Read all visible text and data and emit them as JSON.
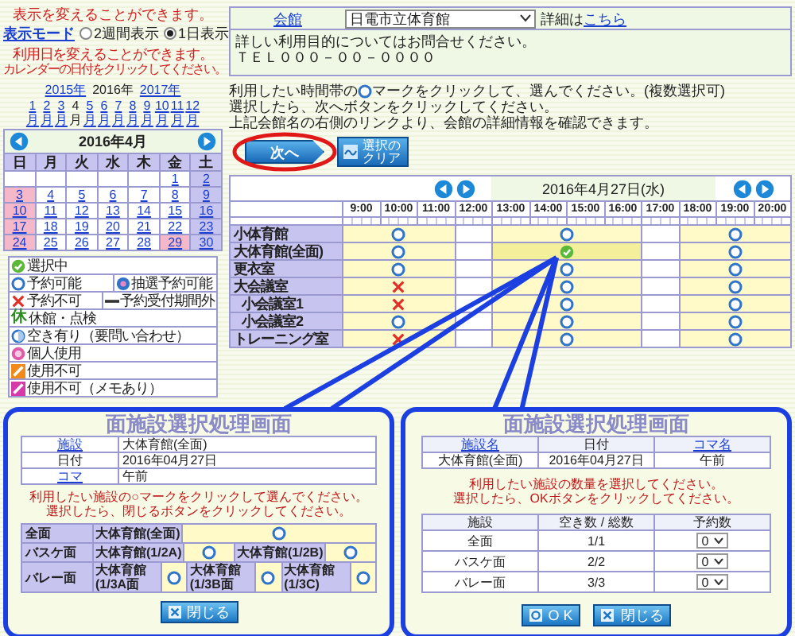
{
  "mode_panel": {
    "hint": "表示を変えることができます。",
    "label": "表示モード",
    "options": [
      {
        "label": "2週間表示",
        "selected": false
      },
      {
        "label": "1日表示",
        "selected": true
      }
    ]
  },
  "date_hint": [
    "利用日を変えることができます。",
    "カレンダーの日付をクリックしてください。"
  ],
  "calendar": {
    "years": [
      {
        "label": "2015年",
        "selected": false
      },
      {
        "label": "2016年",
        "selected": true
      },
      {
        "label": "2017年",
        "selected": false
      }
    ],
    "months": [
      {
        "number": "1",
        "unit": "月",
        "selected": false
      },
      {
        "number": "2",
        "unit": "月",
        "selected": false
      },
      {
        "number": "3",
        "unit": "月",
        "selected": false
      },
      {
        "number": "4",
        "unit": "月",
        "selected": true
      },
      {
        "number": "5",
        "unit": "月",
        "selected": false
      },
      {
        "number": "6",
        "unit": "月",
        "selected": false
      },
      {
        "number": "7",
        "unit": "月",
        "selected": false
      },
      {
        "number": "8",
        "unit": "月",
        "selected": false
      },
      {
        "number": "9",
        "unit": "月",
        "selected": false
      },
      {
        "number": "10",
        "unit": "月",
        "selected": false
      },
      {
        "number": "11",
        "unit": "月",
        "selected": false
      },
      {
        "number": "12",
        "unit": "月",
        "selected": false
      }
    ],
    "title": "2016年4月",
    "weekdays": [
      "日",
      "月",
      "火",
      "水",
      "木",
      "金",
      "土"
    ],
    "weeks": [
      [
        {
          "kind": "empty"
        },
        {
          "kind": "empty"
        },
        {
          "kind": "empty"
        },
        {
          "kind": "empty"
        },
        {
          "kind": "empty"
        },
        {
          "day": "1",
          "kind": "weekday"
        },
        {
          "day": "2",
          "kind": "saturday"
        }
      ],
      [
        {
          "day": "3",
          "kind": "sunday"
        },
        {
          "day": "4",
          "kind": "weekday"
        },
        {
          "day": "5",
          "kind": "weekday"
        },
        {
          "day": "6",
          "kind": "weekday"
        },
        {
          "day": "7",
          "kind": "weekday"
        },
        {
          "day": "8",
          "kind": "weekday"
        },
        {
          "day": "9",
          "kind": "saturday"
        }
      ],
      [
        {
          "day": "10",
          "kind": "sunday"
        },
        {
          "day": "11",
          "kind": "weekday"
        },
        {
          "day": "12",
          "kind": "weekday"
        },
        {
          "day": "13",
          "kind": "weekday"
        },
        {
          "day": "14",
          "kind": "weekday"
        },
        {
          "day": "15",
          "kind": "weekday"
        },
        {
          "day": "16",
          "kind": "saturday"
        }
      ],
      [
        {
          "day": "17",
          "kind": "sunday"
        },
        {
          "day": "18",
          "kind": "weekday"
        },
        {
          "day": "19",
          "kind": "weekday"
        },
        {
          "day": "20",
          "kind": "weekday"
        },
        {
          "day": "21",
          "kind": "weekday"
        },
        {
          "day": "22",
          "kind": "weekday"
        },
        {
          "day": "23",
          "kind": "saturday"
        }
      ],
      [
        {
          "day": "24",
          "kind": "sunday"
        },
        {
          "day": "25",
          "kind": "weekday"
        },
        {
          "day": "26",
          "kind": "weekday"
        },
        {
          "day": "27",
          "kind": "weekday"
        },
        {
          "day": "28",
          "kind": "weekday"
        },
        {
          "day": "29",
          "kind": "sunday"
        },
        {
          "day": "30",
          "kind": "saturday"
        }
      ]
    ]
  },
  "legend": [
    [
      {
        "kind": "selected",
        "label": "選択中"
      }
    ],
    [
      {
        "kind": "available",
        "label": "予約可能"
      },
      {
        "kind": "lottery",
        "label": "抽選予約可能"
      }
    ],
    [
      {
        "kind": "unavailable",
        "label": "予約不可"
      },
      {
        "kind": "outside",
        "label": "予約受付期間外"
      }
    ],
    [
      {
        "kind": "closed",
        "glyph": "休",
        "label": "休館・点検"
      }
    ],
    [
      {
        "kind": "inquiry",
        "label": "空き有り（要問い合わせ）"
      }
    ],
    [
      {
        "kind": "personal",
        "label": "個人使用"
      }
    ],
    [
      {
        "kind": "unusable",
        "label": "使用不可"
      }
    ],
    [
      {
        "kind": "memo",
        "label": "使用不可（メモあり）"
      }
    ]
  ],
  "facility": {
    "label": "会館",
    "select": "日電市立体育館",
    "detail_prefix": "詳細は",
    "detail_link": "こちら"
  },
  "info": [
    "詳しい利用目的についてはお問合せください。",
    "ＴＥＬ０００－００－００００"
  ],
  "instructions": {
    "before_icon": "利用したい時間帯の",
    "after_icon": "マークをクリックして、選んでください。(複数選択可)",
    "lines": [
      "選択したら、次へボタンをクリックしてください。",
      "上記会館名の右側のリンクより、会館の詳細情報を確認できます。"
    ]
  },
  "buttons": {
    "next": "次へ",
    "clear": "選択のクリア"
  },
  "schedule": {
    "date": "2016年4月27日(水)",
    "hours": [
      "9:00",
      "10:00",
      "11:00",
      "12:00",
      "13:00",
      "14:00",
      "15:00",
      "16:00",
      "17:00",
      "18:00",
      "19:00",
      "20:00"
    ],
    "rows": [
      {
        "name": "小体育館",
        "slots": [
          {
            "kind": "available",
            "selected": false
          },
          {
            "kind": "blank"
          },
          {
            "kind": "available",
            "selected": false
          },
          {
            "kind": "blank"
          },
          {
            "kind": "available",
            "selected": false
          }
        ]
      },
      {
        "name": "大体育館(全面)",
        "slots": [
          {
            "kind": "available",
            "selected": false
          },
          {
            "kind": "blank"
          },
          {
            "kind": "available",
            "selected": true
          },
          {
            "kind": "blank"
          },
          {
            "kind": "available",
            "selected": false
          }
        ]
      },
      {
        "name": "更衣室",
        "slots": [
          {
            "kind": "available",
            "selected": false
          },
          {
            "kind": "blank"
          },
          {
            "kind": "available",
            "selected": false
          },
          {
            "kind": "blank"
          },
          {
            "kind": "available",
            "selected": false
          }
        ]
      },
      {
        "name": "大会議室",
        "slots": [
          {
            "kind": "unavailable"
          },
          {
            "kind": "blank"
          },
          {
            "kind": "available",
            "selected": false
          },
          {
            "kind": "blank"
          },
          {
            "kind": "available",
            "selected": false
          }
        ],
        "children": [
          {
            "name": "小会議室1",
            "slots": [
              {
                "kind": "unavailable"
              },
              {
                "kind": "blank"
              },
              {
                "kind": "available",
                "selected": false
              },
              {
                "kind": "blank"
              },
              {
                "kind": "available",
                "selected": false
              }
            ]
          },
          {
            "name": "小会議室2",
            "slots": [
              {
                "kind": "available",
                "selected": false
              },
              {
                "kind": "blank"
              },
              {
                "kind": "available",
                "selected": false
              },
              {
                "kind": "blank"
              },
              {
                "kind": "available",
                "selected": false
              }
            ]
          }
        ]
      },
      {
        "name": "トレーニング室",
        "slots": [
          {
            "kind": "unavailable"
          },
          {
            "kind": "blank"
          },
          {
            "kind": "available",
            "selected": false
          },
          {
            "kind": "blank"
          },
          {
            "kind": "available",
            "selected": false
          }
        ]
      }
    ]
  },
  "popup_left": {
    "title": "面施設選択処理画面",
    "info": [
      {
        "label": "施設",
        "link": true,
        "value": "大体育館(全面)"
      },
      {
        "label": "日付",
        "link": false,
        "value": "2016年04月27日"
      },
      {
        "label": "コマ",
        "link": true,
        "value": "午前"
      }
    ],
    "message": [
      "利用したい施設の○マークをクリックして選んでください。",
      "選択したら、閉じるボタンをクリックしてください。"
    ],
    "groups": [
      {
        "name": "全面",
        "choices": [
          {
            "label": "大体育館(全面)",
            "selected": false
          }
        ]
      },
      {
        "name": "バスケ面",
        "choices": [
          {
            "label": "大体育館(1/2A)",
            "selected": false
          },
          {
            "label": "大体育館(1/2B)",
            "selected": false
          }
        ]
      },
      {
        "name": "バレー面",
        "choices": [
          {
            "label": "大体育館(1/3A面",
            "selected": false
          },
          {
            "label": "大体育館(1/3B面",
            "selected": false
          },
          {
            "label": "大体育館(1/3C)",
            "selected": false
          }
        ]
      }
    ],
    "close": "閉じる"
  },
  "popup_right": {
    "title": "面施設選択処理画面",
    "info_headers": [
      {
        "text": "施設名",
        "link": true
      },
      {
        "text": "日付",
        "link": false
      },
      {
        "text": "コマ名",
        "link": true
      }
    ],
    "info_values": [
      "大体育館(全面)",
      "2016年04月27日",
      "午前"
    ],
    "message": [
      "利用したい施設の数量を選択してください。",
      "選択したら、OKボタンをクリックしてください。"
    ],
    "columns": [
      "施設",
      "空き数 / 総数",
      "予約数"
    ],
    "rows": [
      {
        "name": "全面",
        "availability": "1/1",
        "count": "0"
      },
      {
        "name": "バスケ面",
        "availability": "2/2",
        "count": "0"
      },
      {
        "name": "バレー面",
        "availability": "3/3",
        "count": "0"
      }
    ],
    "ok": "O K",
    "close": "閉じる"
  }
}
